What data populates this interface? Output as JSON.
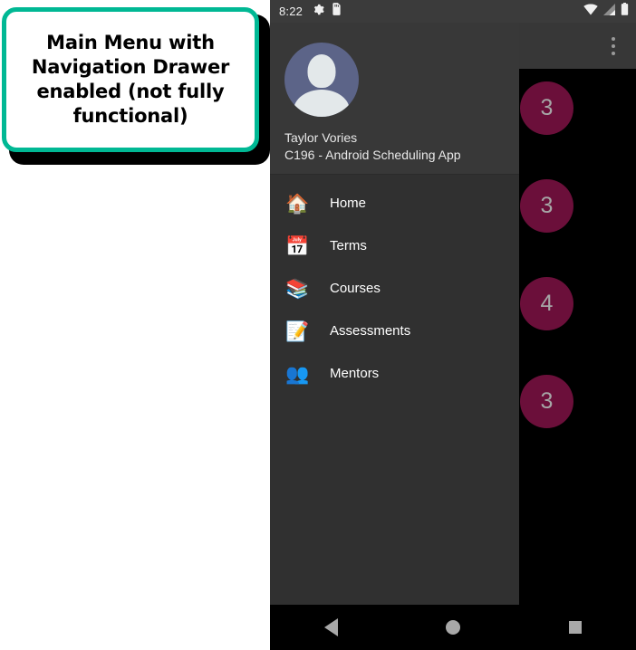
{
  "annotation": {
    "text": "Main Menu with Navigation Drawer enabled (not fully functional)",
    "border_color": "#00b894"
  },
  "phone": {
    "status_bar": {
      "time": "8:22",
      "left_icons": [
        "gear-icon",
        "sd-card-icon"
      ],
      "right_icons": [
        "wifi-icon",
        "cellular-signal-icon",
        "battery-icon"
      ],
      "background": "#3b3b3b"
    },
    "app_bar": {
      "overflow_label": "⋮",
      "background": "#373737"
    },
    "content": {
      "background": "#000000",
      "badge_color": "#6b0f3a",
      "badge_text_color": "#a6a6a6",
      "badges": [
        "3",
        "3",
        "4",
        "3"
      ]
    },
    "drawer": {
      "background": "#303030",
      "header": {
        "background": "#383838",
        "avatar_name": "avatar",
        "avatar_bg": "#5c6488",
        "user_name": "Taylor Vories",
        "subtitle": "C196 - Android Scheduling App"
      },
      "items": [
        {
          "label": "Home",
          "icon": "🏠",
          "icon_name": "house-icon"
        },
        {
          "label": "Terms",
          "icon": "📅",
          "icon_name": "calendar-icon"
        },
        {
          "label": "Courses",
          "icon": "📚",
          "icon_name": "books-icon"
        },
        {
          "label": "Assessments",
          "icon": "📝",
          "icon_name": "clipboard-icon"
        },
        {
          "label": "Mentors",
          "icon": "👥",
          "icon_name": "people-icon"
        }
      ]
    },
    "nav_bar": {
      "back": "back-triangle",
      "home": "home-circle",
      "recents": "recents-square",
      "background": "#000000"
    }
  }
}
